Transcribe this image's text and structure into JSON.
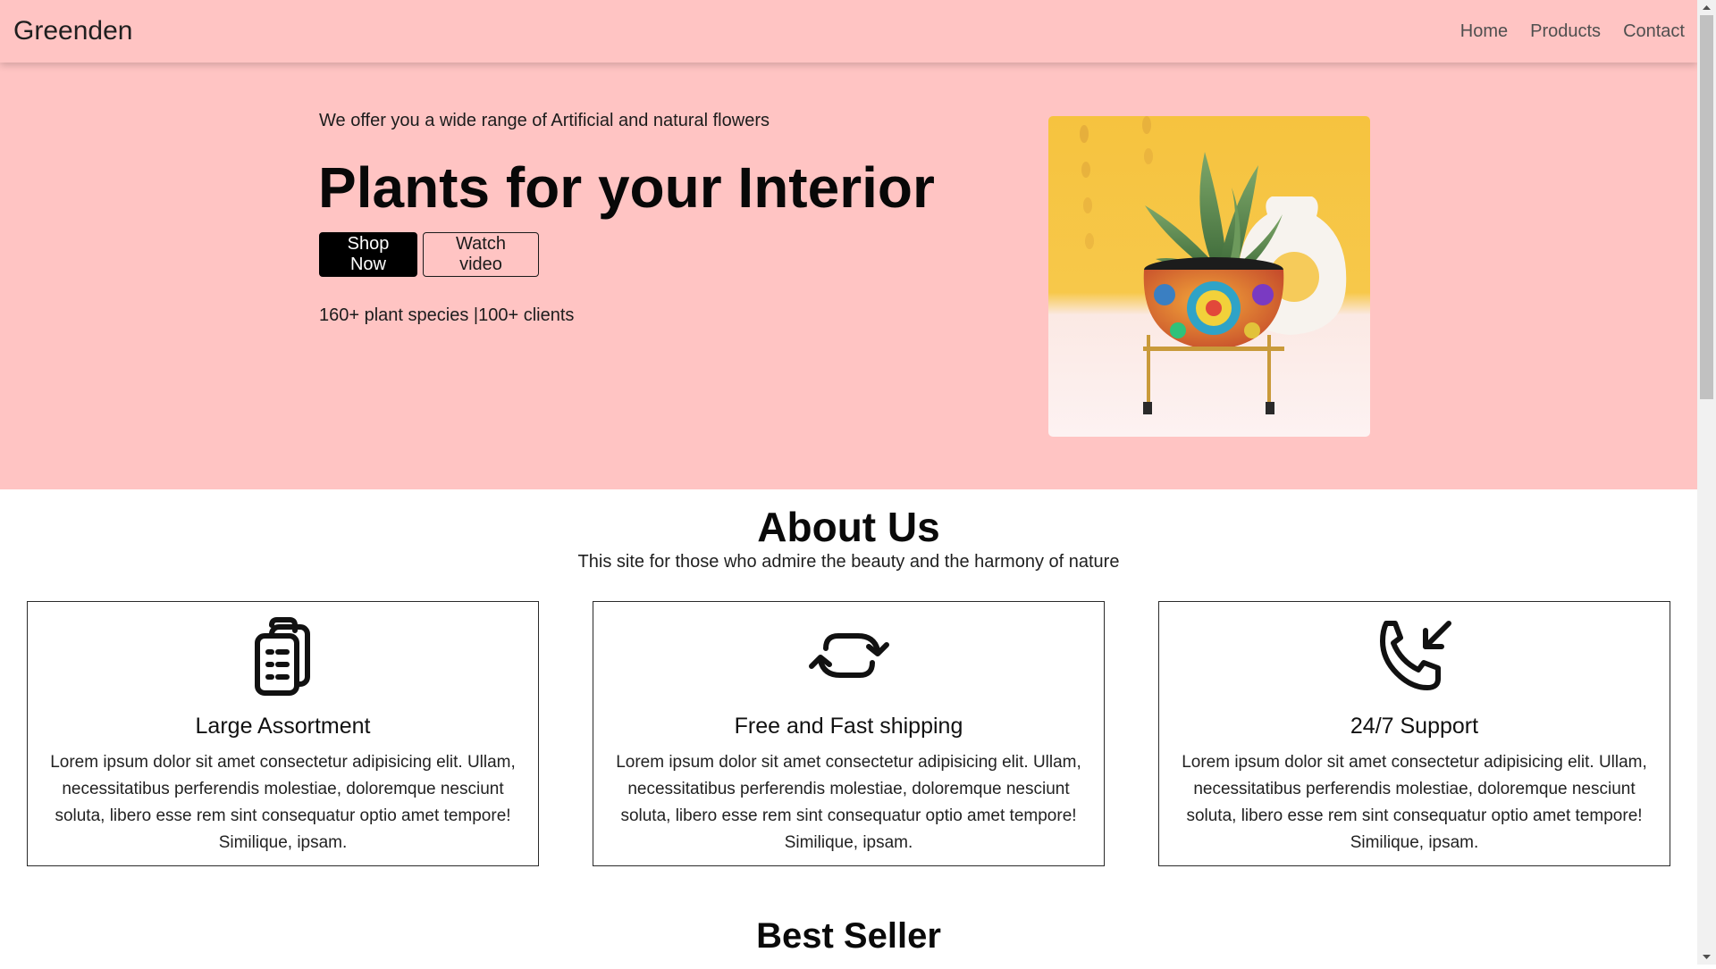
{
  "navbar": {
    "brand": "Greenden",
    "links": [
      "Home",
      "Products",
      "Contact"
    ]
  },
  "hero": {
    "subtitle": "We offer you a wide range of Artificial and natural flowers",
    "title": "Plants for your Interior",
    "primary_button": "Shop Now",
    "secondary_button": "Watch video",
    "stats": "160+ plant species |100+ clients",
    "image_icon": "potted-plant-image"
  },
  "about": {
    "title": "About Us",
    "subtitle": "This site for those who admire the beauty and the harmony of nature",
    "cards": [
      {
        "icon": "clipboard-list-icon",
        "title": "Large Assortment",
        "text": "Lorem ipsum dolor sit amet consectetur adipisicing elit. Ullam, necessitatibus perferendis molestiae, doloremque nesciunt soluta, libero esse rem sint consequatur optio amet tempore! Similique, ipsam."
      },
      {
        "icon": "refresh-arrows-icon",
        "title": "Free and Fast shipping",
        "text": "Lorem ipsum dolor sit amet consectetur adipisicing elit. Ullam, necessitatibus perferendis molestiae, doloremque nesciunt soluta, libero esse rem sint consequatur optio amet tempore! Similique, ipsam."
      },
      {
        "icon": "phone-incoming-icon",
        "title": "24/7 Support",
        "text": "Lorem ipsum dolor sit amet consectetur adipisicing elit. Ullam, necessitatibus perferendis molestiae, doloremque nesciunt soluta, libero esse rem sint consequatur optio amet tempore! Similique, ipsam."
      }
    ]
  },
  "best_seller": {
    "title": "Best Seller"
  },
  "colors": {
    "hero_background": "#ffc4c3",
    "primary_button": "#000000",
    "image_background": "#f6c33f"
  }
}
